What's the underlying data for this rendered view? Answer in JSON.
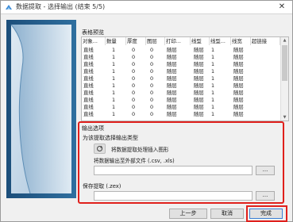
{
  "window": {
    "title": "数据提取 - 选择输出 (结束 5/5)",
    "close_label": "✕"
  },
  "table_preview": {
    "group_title": "表格预览",
    "columns": [
      "对象...",
      "数量",
      "厚度",
      "图层",
      "打印...",
      "线型",
      "线型...",
      "线宽",
      "超链接"
    ],
    "rows": [
      [
        "直线",
        "1",
        "0",
        "0",
        "随层",
        "随层",
        "1",
        "随层",
        ""
      ],
      [
        "直线",
        "1",
        "0",
        "0",
        "随层",
        "随层",
        "1",
        "随层",
        ""
      ],
      [
        "直线",
        "1",
        "0",
        "0",
        "随层",
        "随层",
        "1",
        "随层",
        ""
      ],
      [
        "直线",
        "1",
        "0",
        "0",
        "随层",
        "随层",
        "1",
        "随层",
        ""
      ],
      [
        "直线",
        "1",
        "0",
        "0",
        "随层",
        "随层",
        "1",
        "随层",
        ""
      ],
      [
        "直线",
        "1",
        "0",
        "0",
        "随层",
        "随层",
        "1",
        "随层",
        ""
      ],
      [
        "直线",
        "1",
        "0",
        "0",
        "随层",
        "随层",
        "1",
        "随层",
        ""
      ],
      [
        "直线",
        "1",
        "0",
        "0",
        "随层",
        "随层",
        "1",
        "随层",
        ""
      ],
      [
        "直线",
        "1",
        "0",
        "0",
        "随层",
        "随层",
        "1",
        "随层",
        ""
      ],
      [
        "直线",
        "1",
        "0",
        "0",
        "随层",
        "随层",
        "1",
        "随层",
        ""
      ]
    ]
  },
  "output_options": {
    "group_title": "输出选项",
    "subtitle": "为该提取选择输出类型",
    "option_insert_table": "将数据提取处理插入图形",
    "option_external_file": "将数据输出至外部文件 (.csv, .xls)",
    "file_path_value": "",
    "browse_label": "...",
    "save_extract_label": "保存提取 (.zex)",
    "save_path_value": ""
  },
  "buttons": {
    "back": "上一步",
    "cancel": "取消",
    "finish": "完成"
  },
  "colors": {
    "highlight_border": "#e0201c",
    "accent": "#3c7fd4"
  },
  "icons": {
    "app": "data-extract-icon",
    "side_image": "page-curl-illustration",
    "toggle": "cycle-icon"
  }
}
